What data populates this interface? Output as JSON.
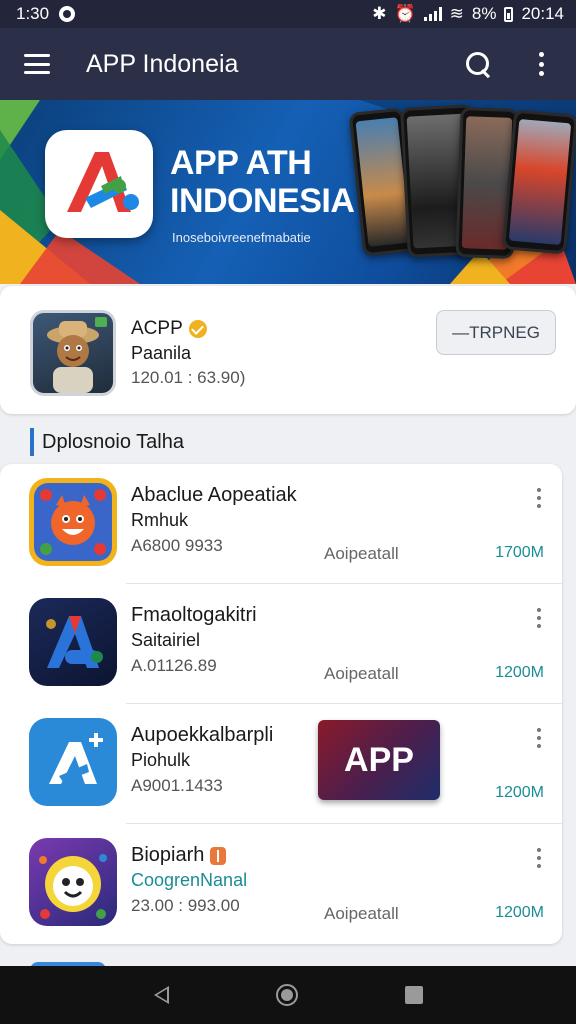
{
  "status_bar": {
    "time": "1:30",
    "battery": "8%",
    "clock_right": "20:14"
  },
  "app_bar": {
    "title": "APP Indoneia"
  },
  "banner": {
    "headline": "APP ATH INDONESIA",
    "subtitle": "Inoseboivreenefmabatie"
  },
  "featured": {
    "name": "ACPP",
    "subtitle": "Paanila",
    "meta": "120.01 : 63.90)",
    "button_label": "—TRPNEG"
  },
  "section": {
    "title": "Dplosnoio Talha"
  },
  "apps": [
    {
      "name": "Abaclue Aopeatiak",
      "subtitle": "Rmhuk",
      "meta": "A6800 9933",
      "status": "Aoipeatall",
      "size": "1700M"
    },
    {
      "name": "Fmaoltogakitri",
      "subtitle": "Saitairiel",
      "meta": "A.01126.89",
      "status": "Aoipeatall",
      "size": "1200M"
    },
    {
      "name": "Aupoekkalbarpli",
      "subtitle": "Piohulk",
      "meta": "A9001.1433",
      "status": "",
      "size": "1200M"
    },
    {
      "name": "Biopiarh",
      "subtitle": "CoogrenNanal",
      "meta": "23.00 : 993.00",
      "status": "Aoipeatall",
      "size": "1200M"
    }
  ],
  "promo": {
    "label": "APP"
  },
  "colors": {
    "app_bar": "#2b2f48",
    "accent": "#2a72c9",
    "teal": "#1a8c95"
  }
}
